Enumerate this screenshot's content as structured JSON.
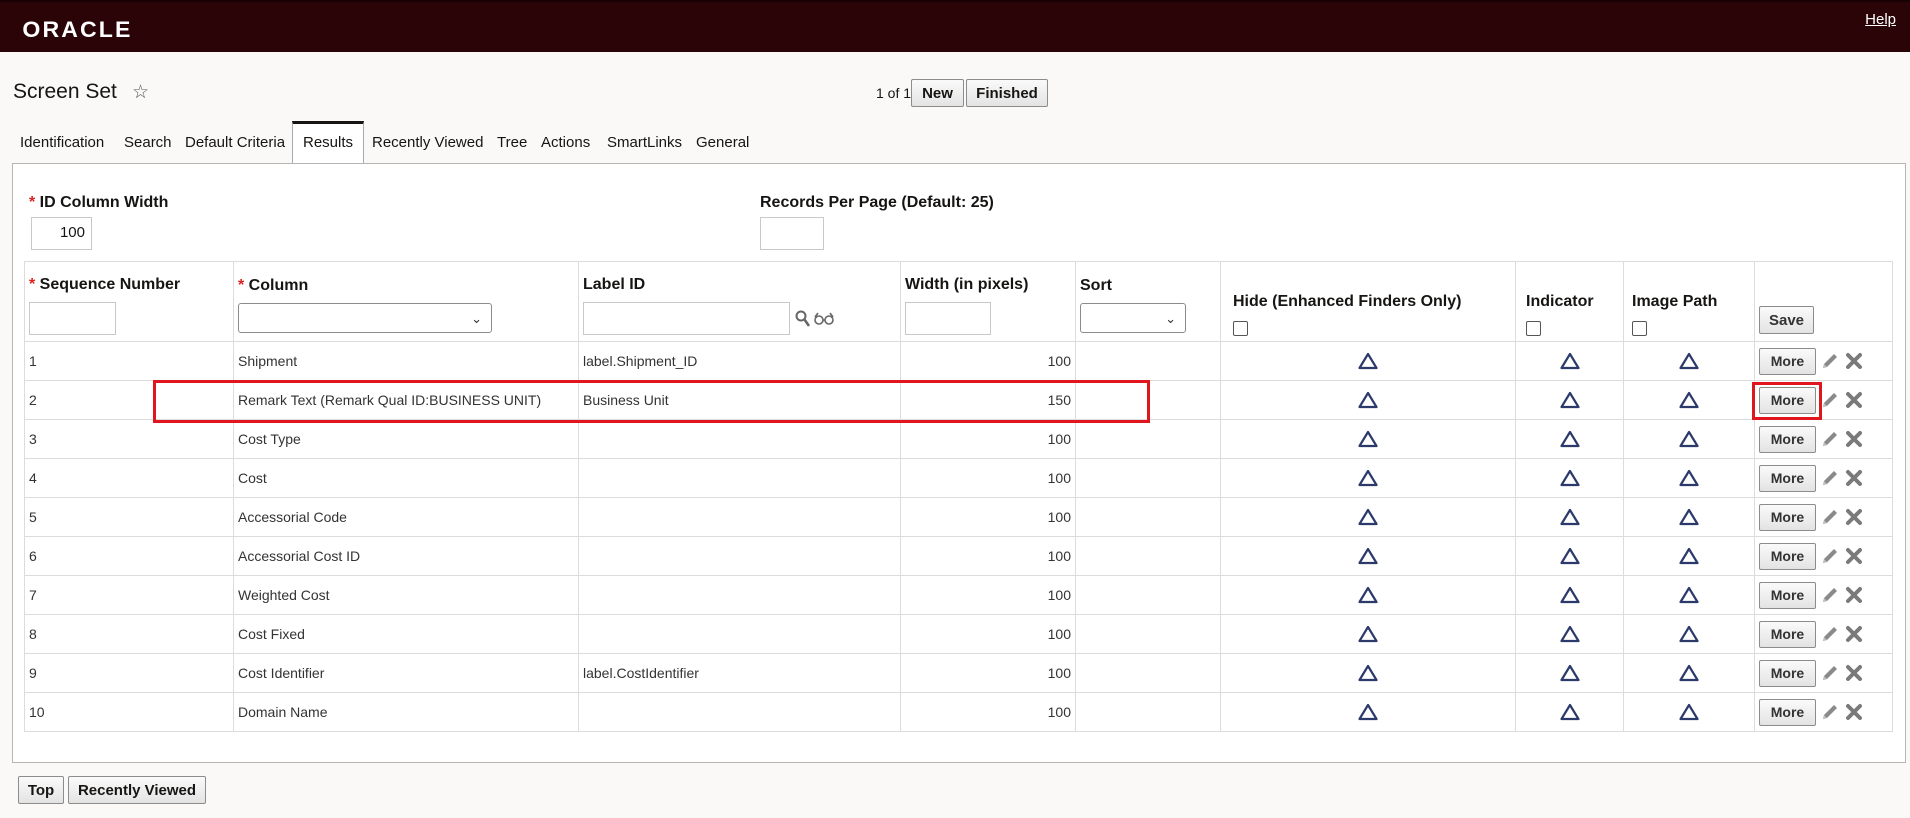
{
  "header": {
    "logo": "ORACLE",
    "help": "Help"
  },
  "page": {
    "title": "Screen Set",
    "pager": "1 of 1",
    "new_label": "New",
    "finished_label": "Finished"
  },
  "tabs": [
    "Identification",
    "Search",
    "Default Criteria",
    "Results",
    "Recently Viewed",
    "Tree",
    "Actions",
    "SmartLinks",
    "General"
  ],
  "active_tab": "Results",
  "form": {
    "id_col_width_label": "ID Column Width",
    "id_col_width_value": "100",
    "records_per_page_label": "Records Per Page (Default: 25)",
    "records_per_page_value": ""
  },
  "grid": {
    "headers": {
      "seq": "Sequence Number",
      "column": "Column",
      "label_id": "Label ID",
      "width": "Width (in pixels)",
      "sort": "Sort",
      "hide": "Hide (Enhanced Finders Only)",
      "indicator": "Indicator",
      "image_path": "Image Path"
    },
    "save_label": "Save",
    "more_label": "More",
    "rows": [
      {
        "seq": "1",
        "column": "Shipment",
        "label_id": "label.Shipment_ID",
        "width": "100"
      },
      {
        "seq": "2",
        "column": "Remark Text (Remark Qual ID:BUSINESS UNIT)",
        "label_id": "Business Unit",
        "width": "150"
      },
      {
        "seq": "3",
        "column": "Cost Type",
        "label_id": "",
        "width": "100"
      },
      {
        "seq": "4",
        "column": "Cost",
        "label_id": "",
        "width": "100"
      },
      {
        "seq": "5",
        "column": "Accessorial Code",
        "label_id": "",
        "width": "100"
      },
      {
        "seq": "6",
        "column": "Accessorial Cost ID",
        "label_id": "",
        "width": "100"
      },
      {
        "seq": "7",
        "column": "Weighted Cost",
        "label_id": "",
        "width": "100"
      },
      {
        "seq": "8",
        "column": "Cost Fixed",
        "label_id": "",
        "width": "100"
      },
      {
        "seq": "9",
        "column": "Cost Identifier",
        "label_id": "label.CostIdentifier",
        "width": "100"
      },
      {
        "seq": "10",
        "column": "Domain Name",
        "label_id": "",
        "width": "100"
      }
    ]
  },
  "footer": {
    "top_label": "Top",
    "recently_viewed_label": "Recently Viewed"
  },
  "colors": {
    "topbar": "#2b0408",
    "highlight": "#e0161f",
    "warn_icon": "#2c3a6b"
  }
}
